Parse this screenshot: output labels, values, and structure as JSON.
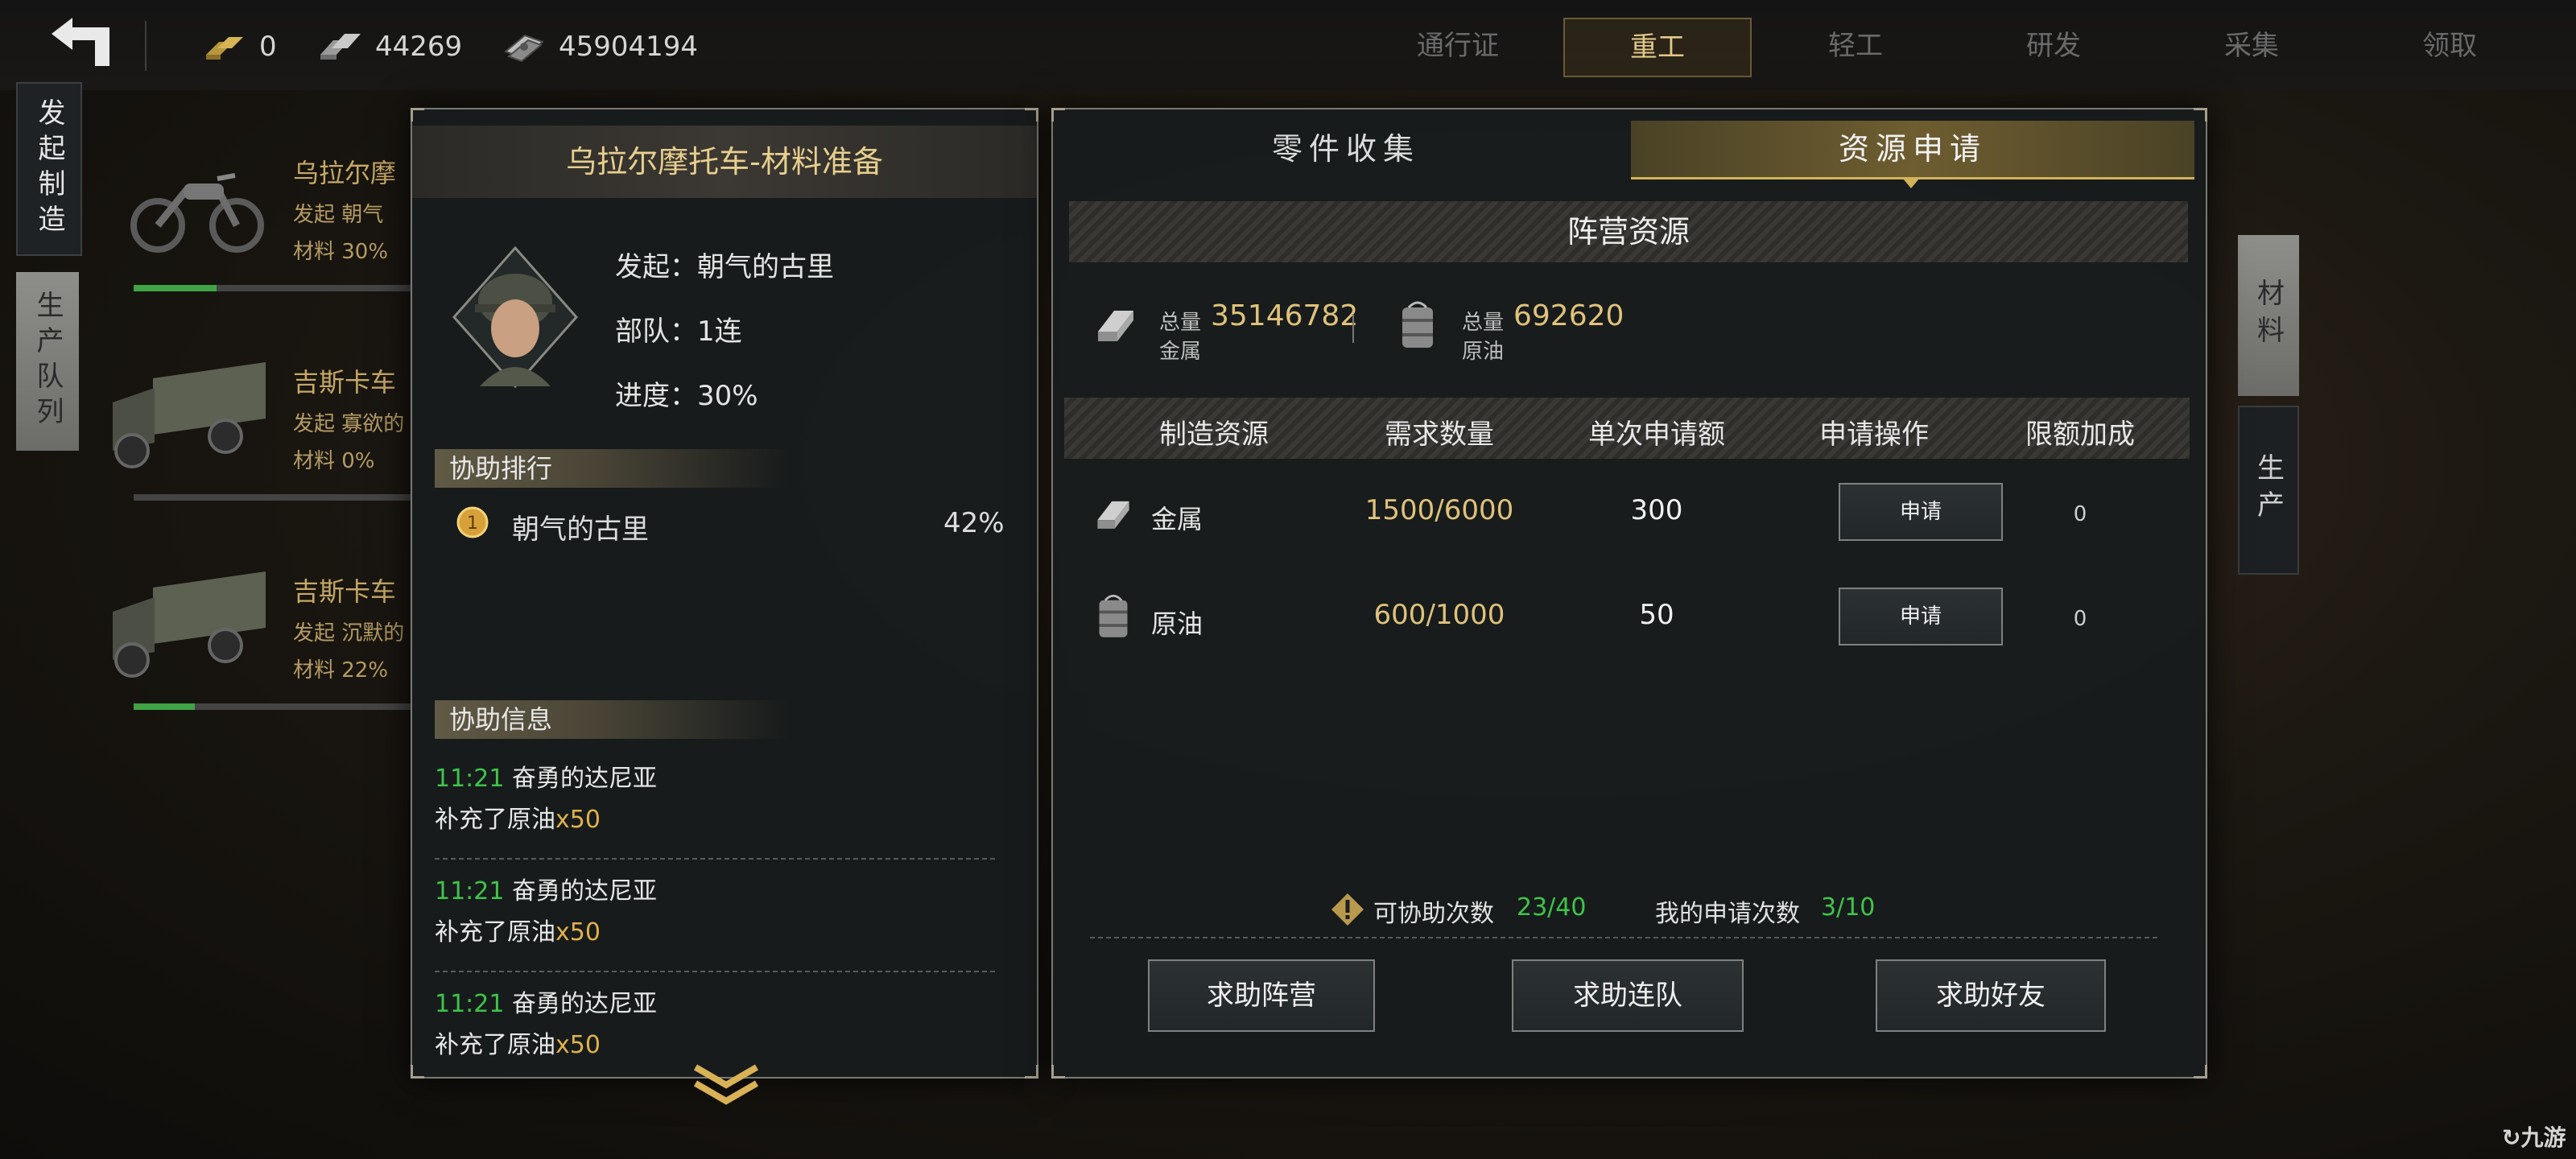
{
  "topbar": {
    "resources": [
      {
        "icon": "gold-bars-icon",
        "value": "0"
      },
      {
        "icon": "metal-ingots-icon",
        "value": "44269"
      },
      {
        "icon": "cash-icon",
        "value": "45904194"
      }
    ],
    "tabs": [
      "通行证",
      "重工",
      "轻工",
      "研发",
      "采集",
      "领取"
    ],
    "active_tab": "重工"
  },
  "side_tabs": {
    "launch": "发起制造",
    "queue": "生产队列",
    "right_material": "材料",
    "right_produce": "生产"
  },
  "background_list": [
    {
      "name": "乌拉尔摩",
      "sub1": "发起  朝气",
      "sub2": "材料  30%",
      "progress": 0.3
    },
    {
      "name": "吉斯卡车",
      "sub1": "发起  寡欲的",
      "sub2": "材料  0%",
      "progress": 0.0
    },
    {
      "name": "吉斯卡车",
      "sub1": "发起  沉默的",
      "sub2": "材料  22%",
      "progress": 0.22
    }
  ],
  "left_panel": {
    "title": "乌拉尔摩托车-材料准备",
    "initiator": "发起：朝气的古里",
    "troop": "部队：1连",
    "progress": "进度：30%",
    "ranking_header": "协助排行",
    "ranking": [
      {
        "name": "朝气的古里",
        "percent": "42%"
      }
    ],
    "info_header": "协助信息",
    "messages": [
      {
        "time": "11:21",
        "name": "奋勇的达尼亚",
        "text": "补充了原油",
        "qty": "x50"
      },
      {
        "time": "11:21",
        "name": "奋勇的达尼亚",
        "text": "补充了原油",
        "qty": "x50"
      },
      {
        "time": "11:21",
        "name": "奋勇的达尼亚",
        "text": "补充了原油",
        "qty": "x50"
      }
    ]
  },
  "right_panel": {
    "tabs": [
      "零件收集",
      "资源申请"
    ],
    "active_tab": "资源申请",
    "section_title": "阵营资源",
    "totals": [
      {
        "label": "总量",
        "value": "35146782",
        "name": "金属"
      },
      {
        "label": "总量",
        "value": "692620",
        "name": "原油"
      }
    ],
    "columns": [
      "制造资源",
      "需求数量",
      "单次申请额",
      "申请操作",
      "限额加成"
    ],
    "rows": [
      {
        "icon": "metal-ingot-icon",
        "resource": "金属",
        "demand": "1500/6000",
        "per_request": "300",
        "action": "申请",
        "bonus": "0"
      },
      {
        "icon": "oil-barrel-icon",
        "resource": "原油",
        "demand": "600/1000",
        "per_request": "50",
        "action": "申请",
        "bonus": "0"
      }
    ],
    "assist_label": "可协助次数",
    "assist_value": "23/40",
    "my_request_label": "我的申请次数",
    "my_request_value": "3/10",
    "buttons": [
      "求助阵营",
      "求助连队",
      "求助好友"
    ]
  },
  "watermark": "九游",
  "colors": {
    "gold": "#e0c27a",
    "green": "#3fc44a",
    "accent_gold": "#c9a95a"
  }
}
